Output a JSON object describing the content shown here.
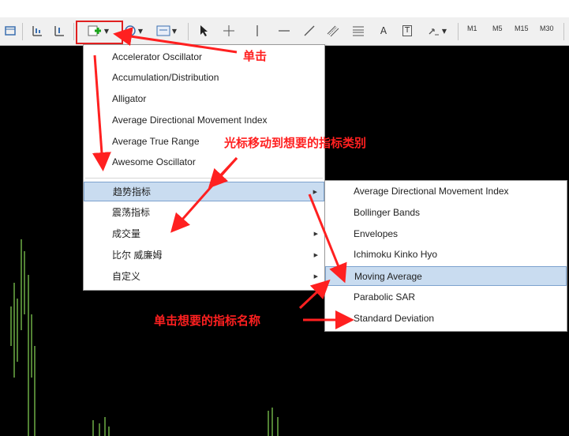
{
  "toolbar": {
    "timeframes": [
      "M1",
      "M5",
      "M15",
      "M30"
    ],
    "text_tool": "A",
    "label_tool": "T"
  },
  "indicator_menu": {
    "items": [
      {
        "label": "Accelerator Oscillator"
      },
      {
        "label": "Accumulation/Distribution"
      },
      {
        "label": "Alligator"
      },
      {
        "label": "Average Directional Movement Index"
      },
      {
        "label": "Average True Range"
      },
      {
        "label": "Awesome Oscillator"
      }
    ],
    "categories": [
      {
        "label": "趋势指标",
        "has_submenu": true,
        "selected": true
      },
      {
        "label": "震荡指标",
        "has_submenu": false
      },
      {
        "label": "成交量",
        "has_submenu": true
      },
      {
        "label": "比尔 威廉姆",
        "has_submenu": true
      },
      {
        "label": "自定义",
        "has_submenu": true
      }
    ]
  },
  "trend_submenu": {
    "items": [
      {
        "label": "Average Directional Movement Index"
      },
      {
        "label": "Bollinger Bands"
      },
      {
        "label": "Envelopes"
      },
      {
        "label": "Ichimoku Kinko Hyo"
      },
      {
        "label": "Moving Average",
        "selected": true
      },
      {
        "label": "Parabolic SAR"
      },
      {
        "label": "Standard Deviation"
      }
    ]
  },
  "annotations": {
    "click": "单击",
    "move_to_category": "光标移动到想要的指标类别",
    "click_indicator_name": "单击想要的指标名称"
  },
  "colors": {
    "annotation": "#ff2020",
    "chart_background": "#000000",
    "bars": "#7ec850",
    "menu_highlight": "#c9dcf0"
  }
}
